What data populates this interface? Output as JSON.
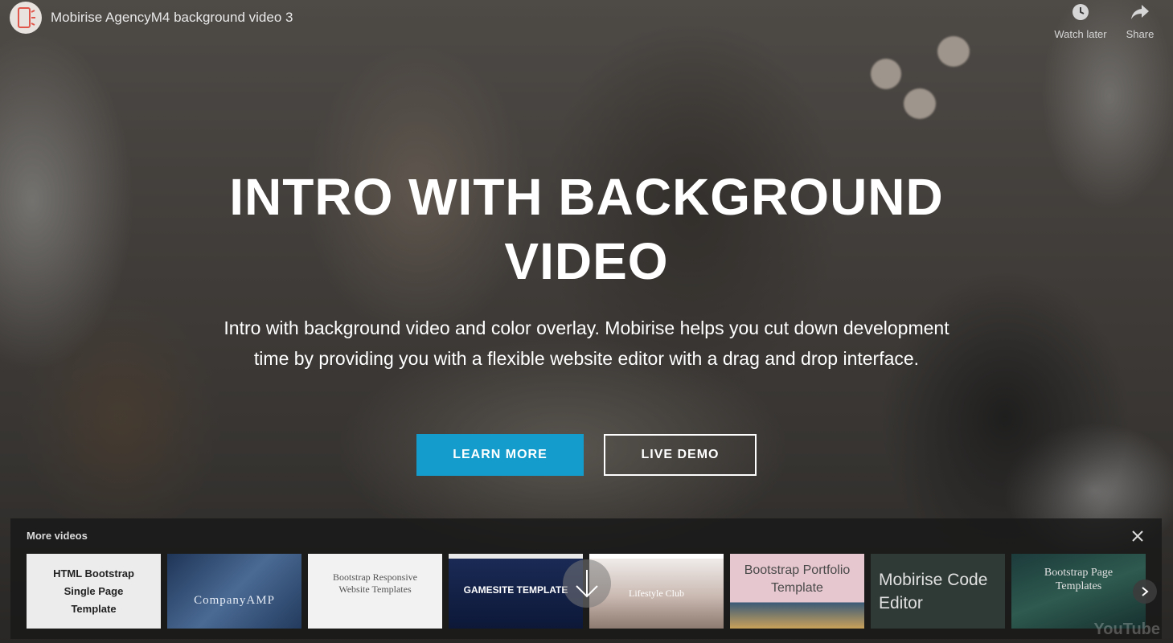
{
  "video": {
    "title": "Mobirise AgencyM4 background video 3",
    "watch_later_label": "Watch later",
    "share_label": "Share"
  },
  "hero": {
    "title_line1": "INTRO WITH BACKGROUND",
    "title_line2": "VIDEO",
    "text": "Intro with background video and color overlay. Mobirise helps you cut down development time by providing you with a flexible website editor with a drag and drop interface.",
    "primary_button": "LEARN MORE",
    "secondary_button": "LIVE DEMO"
  },
  "more_videos": {
    "title": "More videos",
    "items": [
      {
        "label": "HTML Bootstrap Single Page Template"
      },
      {
        "label": "CompanyAMP"
      },
      {
        "label": "Bootstrap Responsive Website Templates"
      },
      {
        "label": "GAMESITE TEMPLATE"
      },
      {
        "label": "Lifestyle Club"
      },
      {
        "label": "Bootstrap Portfolio Template"
      },
      {
        "label": "Mobirise Code Editor"
      },
      {
        "label": "Bootstrap Page Templates"
      }
    ]
  },
  "colors": {
    "primary_button": "#149dcc",
    "overlay": "rgba(20,20,20,0.35)"
  },
  "icons": [
    "mobile-device-icon",
    "clock-icon",
    "share-arrow-icon",
    "close-icon",
    "chevron-right-icon",
    "arrow-down-icon"
  ],
  "brand": "YouTube"
}
